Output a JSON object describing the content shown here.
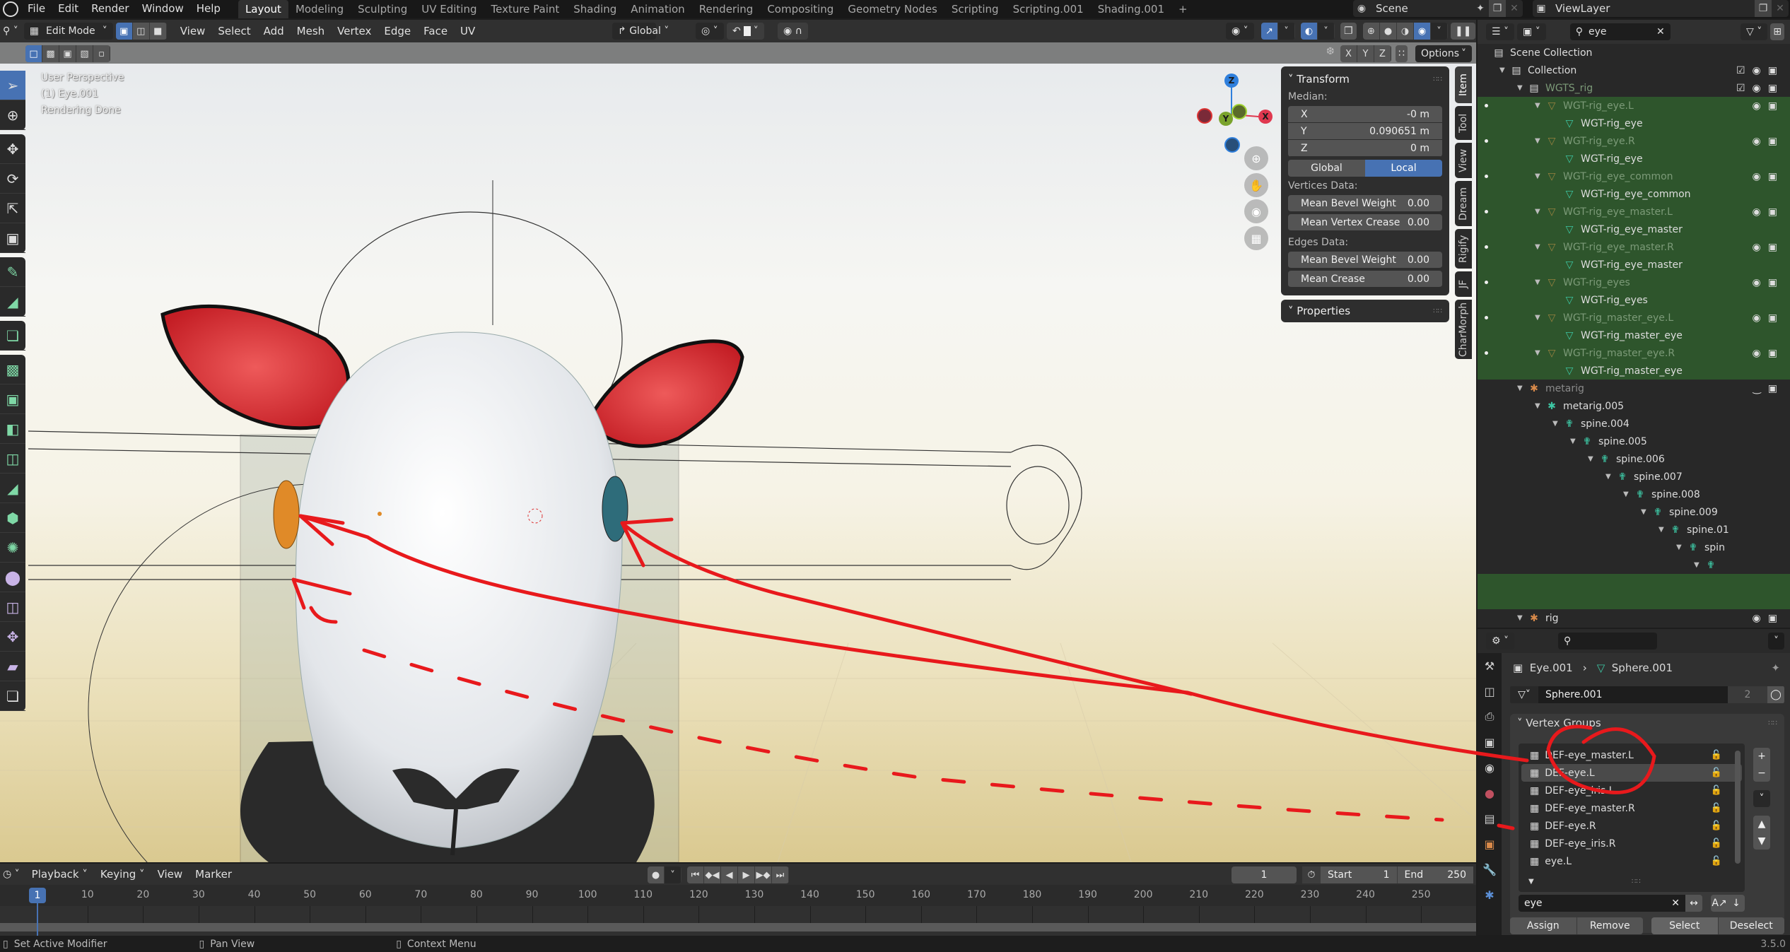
{
  "topbar": {
    "menus": [
      "File",
      "Edit",
      "Render",
      "Window",
      "Help"
    ],
    "workspaces": [
      "Layout",
      "Modeling",
      "Sculpting",
      "UV Editing",
      "Texture Paint",
      "Shading",
      "Animation",
      "Rendering",
      "Compositing",
      "Geometry Nodes",
      "Scripting",
      "Scripting.001",
      "Shading.001"
    ],
    "active_workspace": "Layout",
    "add_workspace": "+",
    "scene": "Scene",
    "view_layer": "ViewLayer"
  },
  "viewport_header": {
    "mode": "Edit Mode",
    "menus": [
      "View",
      "Select",
      "Add",
      "Mesh",
      "Vertex",
      "Edge",
      "Face",
      "UV"
    ],
    "orientation": "Global",
    "axis_x": "X",
    "axis_y": "Y",
    "axis_z": "Z",
    "options": "Options"
  },
  "viewport": {
    "view_name": "User Perspective",
    "object_info": "(1) Eye.001",
    "render_status": "Rendering Done",
    "gizmo": {
      "x": "X",
      "y": "Y",
      "z": "Z"
    },
    "colors": {
      "x": "#e0384f",
      "y": "#7aa32c",
      "z": "#2f7fdc",
      "annotation": "#e8191c"
    }
  },
  "npanel": {
    "transform_title": "Transform",
    "median_label": "Median:",
    "fields": [
      {
        "label": "X",
        "value": "-0 m"
      },
      {
        "label": "Y",
        "value": "0.090651 m"
      },
      {
        "label": "Z",
        "value": "0 m"
      }
    ],
    "space_options": [
      "Global",
      "Local"
    ],
    "active_space": "Local",
    "vertices_data_label": "Vertices Data:",
    "vertices_fields": [
      {
        "label": "Mean Bevel Weight",
        "value": "0.00"
      },
      {
        "label": "Mean Vertex Crease",
        "value": "0.00"
      }
    ],
    "edges_data_label": "Edges Data:",
    "edges_fields": [
      {
        "label": "Mean Bevel Weight",
        "value": "0.00"
      },
      {
        "label": "Mean Crease",
        "value": "0.00"
      }
    ],
    "properties_title": "Properties",
    "tabs": [
      "Item",
      "Tool",
      "View",
      "Dream",
      "Rigify",
      "JF",
      "CharMorph"
    ]
  },
  "outliner": {
    "search": "eye",
    "rows": [
      {
        "label": "Scene Collection",
        "depth": 0,
        "icon": "collection-icon",
        "kind": "scene"
      },
      {
        "label": "Collection",
        "depth": 1,
        "icon": "collection-icon",
        "kind": "collection"
      },
      {
        "label": "WGTS_rig",
        "depth": 2,
        "icon": "collection-icon",
        "kind": "collection-muted"
      },
      {
        "label": "WGT-rig_eye.L",
        "depth": 3,
        "icon": "mesh-object-icon",
        "kind": "object",
        "green": true
      },
      {
        "label": "WGT-rig_eye",
        "depth": 4,
        "icon": "mesh-data-icon",
        "kind": "data",
        "green": true
      },
      {
        "label": "WGT-rig_eye.R",
        "depth": 3,
        "icon": "mesh-object-icon",
        "kind": "object",
        "green": true
      },
      {
        "label": "WGT-rig_eye",
        "depth": 4,
        "icon": "mesh-data-icon",
        "kind": "data",
        "green": true
      },
      {
        "label": "WGT-rig_eye_common",
        "depth": 3,
        "icon": "mesh-object-icon",
        "kind": "object",
        "green": true
      },
      {
        "label": "WGT-rig_eye_common",
        "depth": 4,
        "icon": "mesh-data-icon",
        "kind": "data",
        "green": true
      },
      {
        "label": "WGT-rig_eye_master.L",
        "depth": 3,
        "icon": "mesh-object-icon",
        "kind": "object",
        "green": true
      },
      {
        "label": "WGT-rig_eye_master",
        "depth": 4,
        "icon": "mesh-data-icon",
        "kind": "data",
        "green": true
      },
      {
        "label": "WGT-rig_eye_master.R",
        "depth": 3,
        "icon": "mesh-object-icon",
        "kind": "object",
        "green": true
      },
      {
        "label": "WGT-rig_eye_master",
        "depth": 4,
        "icon": "mesh-data-icon",
        "kind": "data",
        "green": true
      },
      {
        "label": "WGT-rig_eyes",
        "depth": 3,
        "icon": "mesh-object-icon",
        "kind": "object",
        "green": true
      },
      {
        "label": "WGT-rig_eyes",
        "depth": 4,
        "icon": "mesh-data-icon",
        "kind": "data",
        "green": true
      },
      {
        "label": "WGT-rig_master_eye.L",
        "depth": 3,
        "icon": "mesh-object-icon",
        "kind": "object",
        "green": true
      },
      {
        "label": "WGT-rig_master_eye",
        "depth": 4,
        "icon": "mesh-data-icon",
        "kind": "data",
        "green": true
      },
      {
        "label": "WGT-rig_master_eye.R",
        "depth": 3,
        "icon": "mesh-object-icon",
        "kind": "object",
        "green": true
      },
      {
        "label": "WGT-rig_master_eye",
        "depth": 4,
        "icon": "mesh-data-icon",
        "kind": "data",
        "green": true
      },
      {
        "label": "metarig",
        "depth": 2,
        "icon": "armature-object-icon",
        "kind": "armature-muted"
      },
      {
        "label": "metarig.005",
        "depth": 3,
        "icon": "armature-data-icon",
        "kind": "armature-data"
      },
      {
        "label": "spine.004",
        "depth": 4,
        "icon": "bone-icon",
        "kind": "bone"
      },
      {
        "label": "spine.005",
        "depth": 5,
        "icon": "bone-icon",
        "kind": "bone"
      },
      {
        "label": "spine.006",
        "depth": 6,
        "icon": "bone-icon",
        "kind": "bone"
      },
      {
        "label": "spine.007",
        "depth": 7,
        "icon": "bone-icon",
        "kind": "bone"
      },
      {
        "label": "spine.008",
        "depth": 8,
        "icon": "bone-icon",
        "kind": "bone"
      },
      {
        "label": "spine.009",
        "depth": 9,
        "icon": "bone-icon",
        "kind": "bone"
      },
      {
        "label": "spine.01",
        "depth": 10,
        "icon": "bone-icon",
        "kind": "bone"
      },
      {
        "label": "spin",
        "depth": 11,
        "icon": "bone-icon",
        "kind": "bone"
      },
      {
        "label": "",
        "depth": 12,
        "icon": "bone-icon",
        "kind": "bone"
      },
      {
        "label": "",
        "depth": 13,
        "icon": "",
        "kind": "empty",
        "green": true
      },
      {
        "label": "",
        "depth": 13,
        "icon": "",
        "kind": "empty",
        "green": true
      },
      {
        "label": "rig",
        "depth": 2,
        "icon": "armature-object-icon",
        "kind": "armature"
      }
    ]
  },
  "properties": {
    "breadcrumb_object": "Eye.001",
    "breadcrumb_data": "Sphere.001",
    "mesh_name": "Sphere.001",
    "users_count": "2",
    "vertex_groups_title": "Vertex Groups",
    "vertex_groups": [
      {
        "name": "DEF-eye_master.L",
        "selected": false
      },
      {
        "name": "DEF-eye.L",
        "selected": true
      },
      {
        "name": "DEF-eye_iris.L",
        "selected": false
      },
      {
        "name": "DEF-eye_master.R",
        "selected": false
      },
      {
        "name": "DEF-eye.R",
        "selected": false
      },
      {
        "name": "DEF-eye_iris.R",
        "selected": false
      },
      {
        "name": "eye.L",
        "selected": false
      }
    ],
    "filter_value": "eye",
    "buttons": {
      "assign": "Assign",
      "remove": "Remove",
      "select": "Select",
      "deselect": "Deselect"
    }
  },
  "timeline": {
    "menus": [
      "Playback",
      "Keying",
      "View",
      "Marker"
    ],
    "current_frame": "1",
    "start_label": "Start",
    "start_value": "1",
    "end_label": "End",
    "end_value": "250",
    "ticks": [
      "10",
      "20",
      "30",
      "40",
      "50",
      "60",
      "70",
      "80",
      "90",
      "100",
      "110",
      "120",
      "130",
      "140",
      "150",
      "160",
      "170",
      "180",
      "190",
      "200",
      "210",
      "220",
      "230",
      "240",
      "250"
    ],
    "cursor_frame": "1"
  },
  "statusbar": {
    "hint_left": "Set Active Modifier",
    "hint_middle": "Pan View",
    "hint_right": "Context Menu",
    "version": "3.5.0"
  }
}
